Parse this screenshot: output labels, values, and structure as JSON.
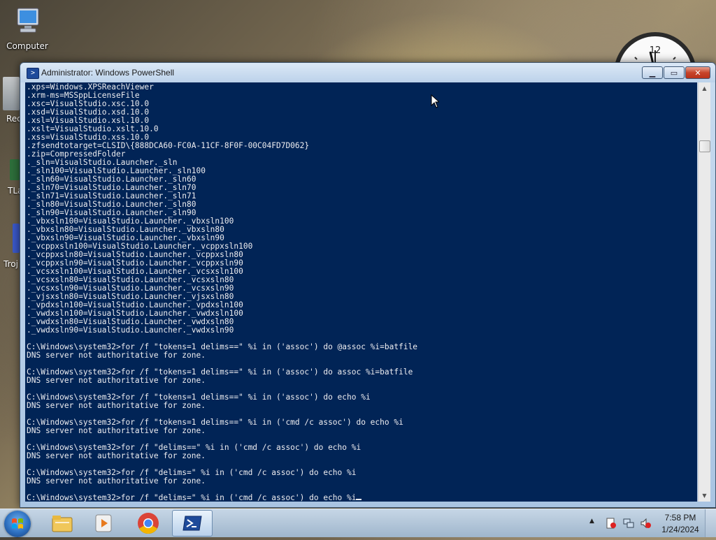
{
  "desktop": {
    "icons": [
      {
        "label": "Computer"
      }
    ],
    "partial_labels": [
      "Rec",
      "TLa",
      "Troj"
    ]
  },
  "window": {
    "title": "Administrator: Windows PowerShell",
    "console_lines": [
      ".xps=Windows.XPSReachViewer",
      ".xrm-ms=MSSppLicenseFile",
      ".xsc=VisualStudio.xsc.10.0",
      ".xsd=VisualStudio.xsd.10.0",
      ".xsl=VisualStudio.xsl.10.0",
      ".xslt=VisualStudio.xslt.10.0",
      ".xss=VisualStudio.xss.10.0",
      ".zfsendtotarget=CLSID\\{888DCA60-FC0A-11CF-8F0F-00C04FD7D062}",
      ".zip=CompressedFolder",
      "._sln=VisualStudio.Launcher._sln",
      "._sln100=VisualStudio.Launcher._sln100",
      "._sln60=VisualStudio.Launcher._sln60",
      "._sln70=VisualStudio.Launcher._sln70",
      "._sln71=VisualStudio.Launcher._sln71",
      "._sln80=VisualStudio.Launcher._sln80",
      "._sln90=VisualStudio.Launcher._sln90",
      "._vbxsln100=VisualStudio.Launcher._vbxsln100",
      "._vbxsln80=VisualStudio.Launcher._vbxsln80",
      "._vbxsln90=VisualStudio.Launcher._vbxsln90",
      "._vcppxsln100=VisualStudio.Launcher._vcppxsln100",
      "._vcppxsln80=VisualStudio.Launcher._vcppxsln80",
      "._vcppxsln90=VisualStudio.Launcher._vcppxsln90",
      "._vcsxsln100=VisualStudio.Launcher._vcsxsln100",
      "._vcsxsln80=VisualStudio.Launcher._vcsxsln80",
      "._vcsxsln90=VisualStudio.Launcher._vcsxsln90",
      "._vjsxsln80=VisualStudio.Launcher._vjsxsln80",
      "._vpdxsln100=VisualStudio.Launcher._vpdxsln100",
      "._vwdxsln100=VisualStudio.Launcher._vwdxsln100",
      "._vwdxsln80=VisualStudio.Launcher._vwdxsln80",
      "._vwdxsln90=VisualStudio.Launcher._vwdxsln90",
      "",
      "C:\\Windows\\system32>for /f \"tokens=1 delims==\" %i in ('assoc') do @assoc %i=batfile",
      "DNS server not authoritative for zone.",
      "",
      "C:\\Windows\\system32>for /f \"tokens=1 delims==\" %i in ('assoc') do assoc %i=batfile",
      "DNS server not authoritative for zone.",
      "",
      "C:\\Windows\\system32>for /f \"tokens=1 delims==\" %i in ('assoc') do echo %i",
      "DNS server not authoritative for zone.",
      "",
      "C:\\Windows\\system32>for /f \"tokens=1 delims==\" %i in ('cmd /c assoc') do echo %i",
      "DNS server not authoritative for zone.",
      "",
      "C:\\Windows\\system32>for /f \"delims==\" %i in ('cmd /c assoc') do echo %i",
      "DNS server not authoritative for zone.",
      "",
      "C:\\Windows\\system32>for /f \"delims=\" %i in ('cmd /c assoc') do echo %i",
      "DNS server not authoritative for zone.",
      ""
    ],
    "current_input": "C:\\Windows\\system32>for /f \"delims=\" %i in ('cmd /c assoc') do echo %i"
  },
  "taskbar": {
    "pinned": [
      "explorer-icon",
      "media-player-icon",
      "chrome-icon",
      "powershell-icon"
    ],
    "clock_time": "7:58 PM",
    "clock_date": "1/24/2024"
  },
  "colors": {
    "console_bg": "#012456",
    "console_fg": "#eeedf0"
  }
}
